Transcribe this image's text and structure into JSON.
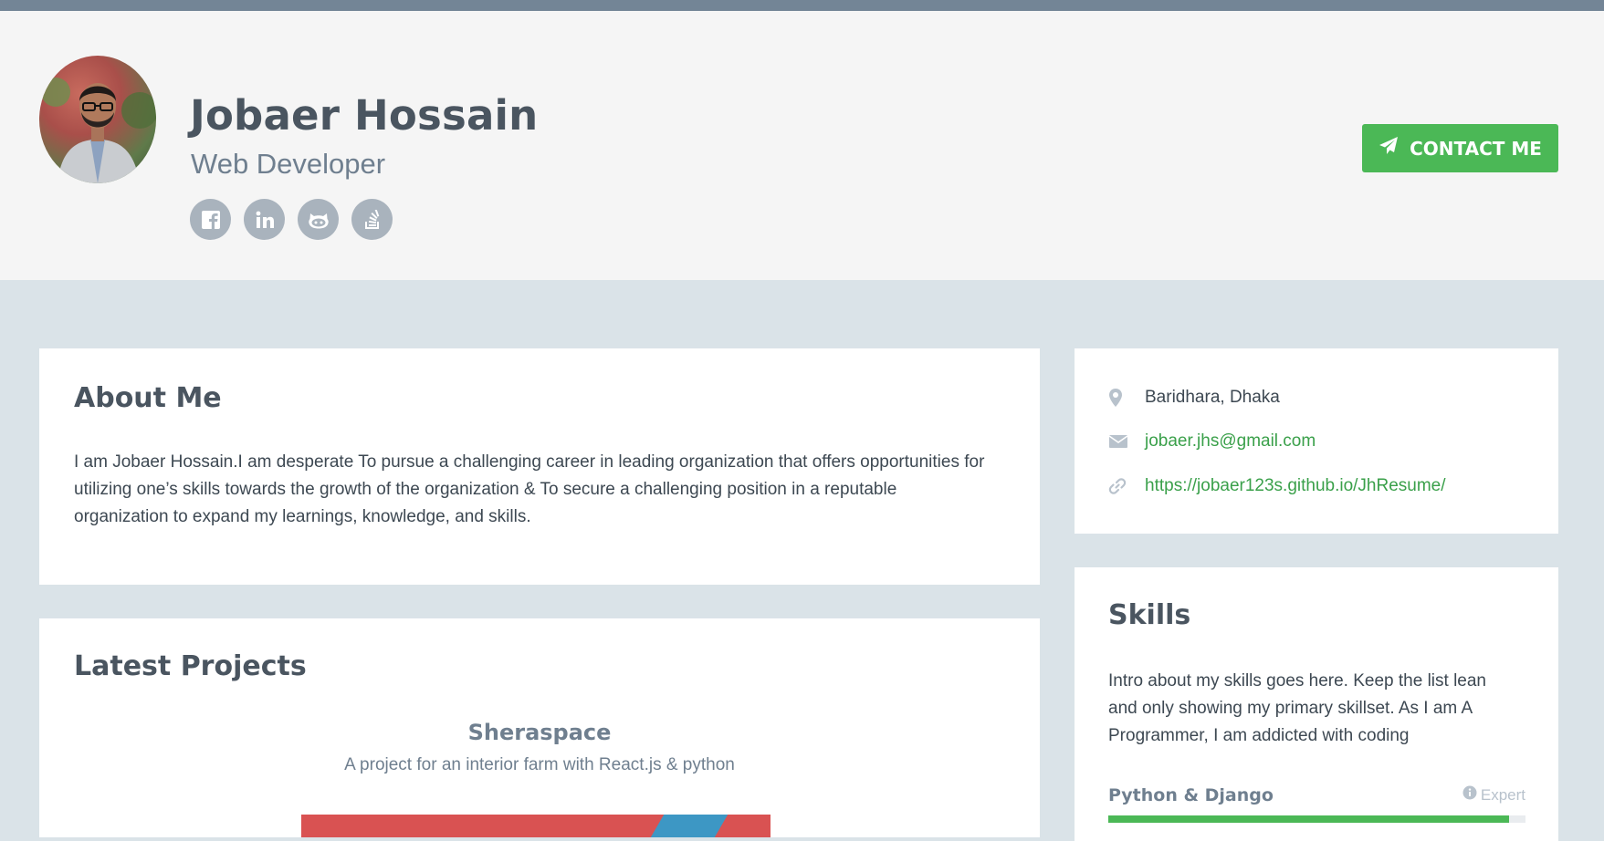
{
  "profile": {
    "name": "Jobaer Hossain",
    "tagline": "Web Developer",
    "socials": [
      "facebook-icon",
      "linkedin-icon",
      "github-icon",
      "stack-overflow-icon"
    ],
    "contact_button": "CONTACT ME"
  },
  "about": {
    "title": "About Me",
    "text": "I am Jobaer Hossain.I am desperate To pursue a challenging career in leading organization that offers opportunities for utilizing one’s skills towards the growth of the organization & To secure a challenging position in a reputable organization to expand my learnings, knowledge, and skills."
  },
  "projects": {
    "title": "Latest Projects",
    "items": [
      {
        "name": "Sheraspace",
        "description": "A project for an interior farm with React.js & python"
      }
    ]
  },
  "contact": {
    "location": "Baridhara, Dhaka",
    "email": "jobaer.jhs@gmail.com",
    "website": "https://jobaer123s.github.io/JhResume/"
  },
  "skills": {
    "title": "Skills",
    "intro": "Intro about my skills goes here. Keep the list lean and only showing my primary skillset. As I am A Programmer, I am addicted with coding",
    "items": [
      {
        "name": "Python & Django",
        "level": "Expert",
        "percent": 96
      }
    ]
  },
  "colors": {
    "accent_green": "#4bb856",
    "link_green": "#3aa04a",
    "header_bg": "#f5f5f5",
    "page_bg": "#dae3e8",
    "top_strip": "#738596",
    "social_bg": "#a9b3bd"
  }
}
